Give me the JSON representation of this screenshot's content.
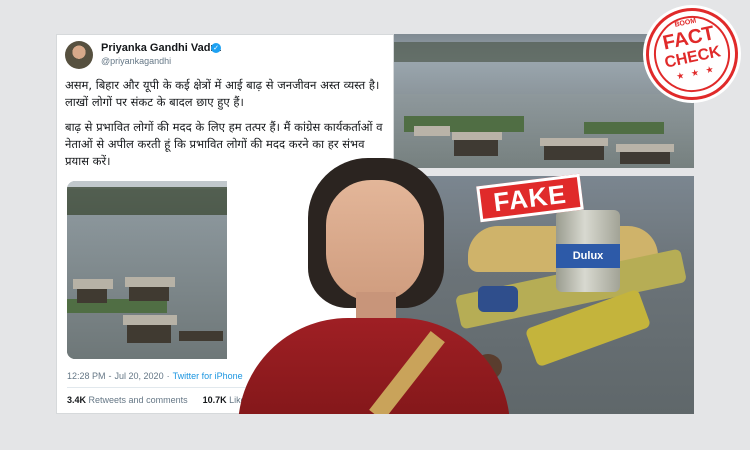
{
  "tweet": {
    "user_name": "Priyanka Gandhi Vadra",
    "user_handle": "@priyankagandhi",
    "paragraph1": "असम, बिहार और यूपी के कई क्षेत्रों में आई बाढ़ से जनजीवन अस्त व्यस्त है। लाखों लोगों पर संकट के बादल छाए हुए हैं।",
    "paragraph2": "बाढ़ से प्रभावित लोगों की मदद के लिए हम तत्पर हैं। मैं कांग्रेस कार्यकर्ताओं व नेताओं से अपील करती हूं कि प्रभावित लोगों की मदद करने का हर संभव प्रयास करें।",
    "time": "12:28 PM",
    "date": "Jul 20, 2020",
    "source": "Twitter for iPhone",
    "retweets_count": "3.4K",
    "retweets_label": "Retweets and comments",
    "likes_count": "10.7K",
    "likes_label": "Likes"
  },
  "stamp": {
    "fake_label": "FAKE"
  },
  "badge": {
    "top": "BOOM",
    "fact": "FACT",
    "check": "CHECK",
    "stars": "★ ★ ★"
  },
  "photo": {
    "tin_brand": "Dulux"
  },
  "colors": {
    "accent_red": "#e02a2a",
    "twitter_blue": "#1da1f2"
  }
}
